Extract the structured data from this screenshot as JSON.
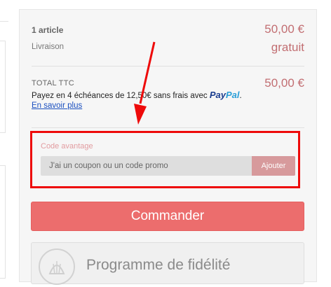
{
  "summary": {
    "articles_label": "1 article",
    "articles_price": "50,00 €",
    "shipping_label": "Livraison",
    "shipping_value": "gratuit",
    "total_label": "TOTAL TTC",
    "total_value": "50,00 €"
  },
  "paypal": {
    "installment_text": "Payez en 4 échéances de 12,50€ sans frais avec",
    "logo_pay": "Pay",
    "logo_pal": "Pal",
    "learn_more": "En savoir plus"
  },
  "promo": {
    "label": "Code avantage",
    "placeholder": "J'ai un coupon ou un code promo",
    "apply_label": "Ajouter"
  },
  "order_button": "Commander",
  "loyalty": {
    "title": "Programme de fidélité"
  },
  "colors": {
    "accent": "#ec6d6d",
    "price": "#c26e72",
    "annotation": "#ee0a0a",
    "link": "#1a4fbf"
  }
}
